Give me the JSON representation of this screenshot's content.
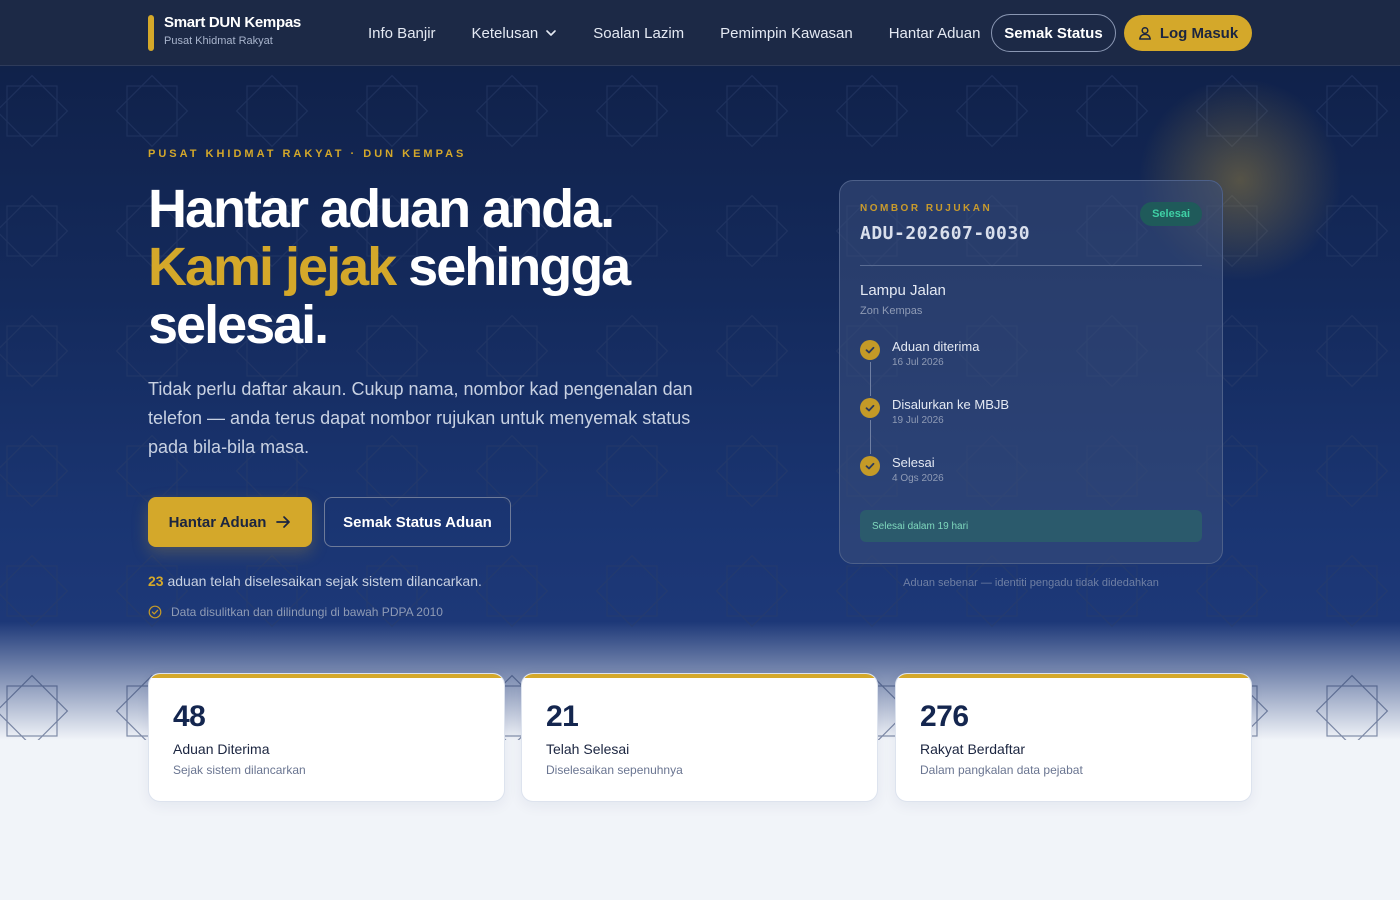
{
  "brand": {
    "title": "Smart DUN Kempas",
    "subtitle": "Pusat Khidmat Rakyat"
  },
  "nav": {
    "links": [
      {
        "label": "Info Banjir"
      },
      {
        "label": "Ketelusan",
        "has_dropdown": true
      },
      {
        "label": "Soalan Lazim"
      },
      {
        "label": "Pemimpin Kawasan"
      },
      {
        "label": "Hantar Aduan"
      }
    ],
    "status_button": "Semak Status",
    "login_button": "Log Masuk"
  },
  "hero": {
    "eyebrow": "PUSAT KHIDMAT RAKYAT · DUN KEMPAS",
    "headline_line1": "Hantar aduan anda.",
    "headline_gold": "Kami jejak",
    "headline_rest": "sehingga selesai.",
    "lede": "Tidak perlu daftar akaun. Cukup nama, nombor kad pengenalan dan telefon — anda terus dapat nombor rujukan untuk menyemak status pada bila-bila masa.",
    "primary_button": "Hantar Aduan",
    "secondary_button": "Semak Status Aduan",
    "resolved_count": "23",
    "resolved_text": "aduan telah diselesaikan sejak sistem dilancarkan.",
    "pdpa_text": "Data disulitkan dan dilindungi di bawah PDPA 2010"
  },
  "tracking_card": {
    "ref_label": "NOMBOR RUJUKAN",
    "ref_number": "ADU-202607-0030",
    "badge": "Selesai",
    "title": "Lampu Jalan",
    "zone": "Zon Kempas",
    "steps": [
      {
        "title": "Aduan diterima",
        "date": "16 Jul 2026"
      },
      {
        "title": "Disalurkan ke MBJB",
        "date": "19 Jul 2026"
      },
      {
        "title": "Selesai",
        "date": "4 Ogs 2026"
      }
    ],
    "footer": "Selesai dalam 19 hari",
    "caption": "Aduan sebenar — identiti pengadu tidak didedahkan"
  },
  "stats": [
    {
      "value": "48",
      "label": "Aduan Diterima",
      "sub": "Sejak sistem dilancarkan"
    },
    {
      "value": "21",
      "label": "Telah Selesai",
      "sub": "Diselesaikan sepenuhnya"
    },
    {
      "value": "276",
      "label": "Rakyat Berdaftar",
      "sub": "Dalam pangkalan data pejabat"
    }
  ],
  "colors": {
    "navy": "#14264f",
    "gold": "#d4a82a",
    "success": "#3fd0a5"
  },
  "icons": [
    "chevron-down-icon",
    "user-icon",
    "arrow-right-icon",
    "shield-check-icon",
    "check-icon"
  ]
}
